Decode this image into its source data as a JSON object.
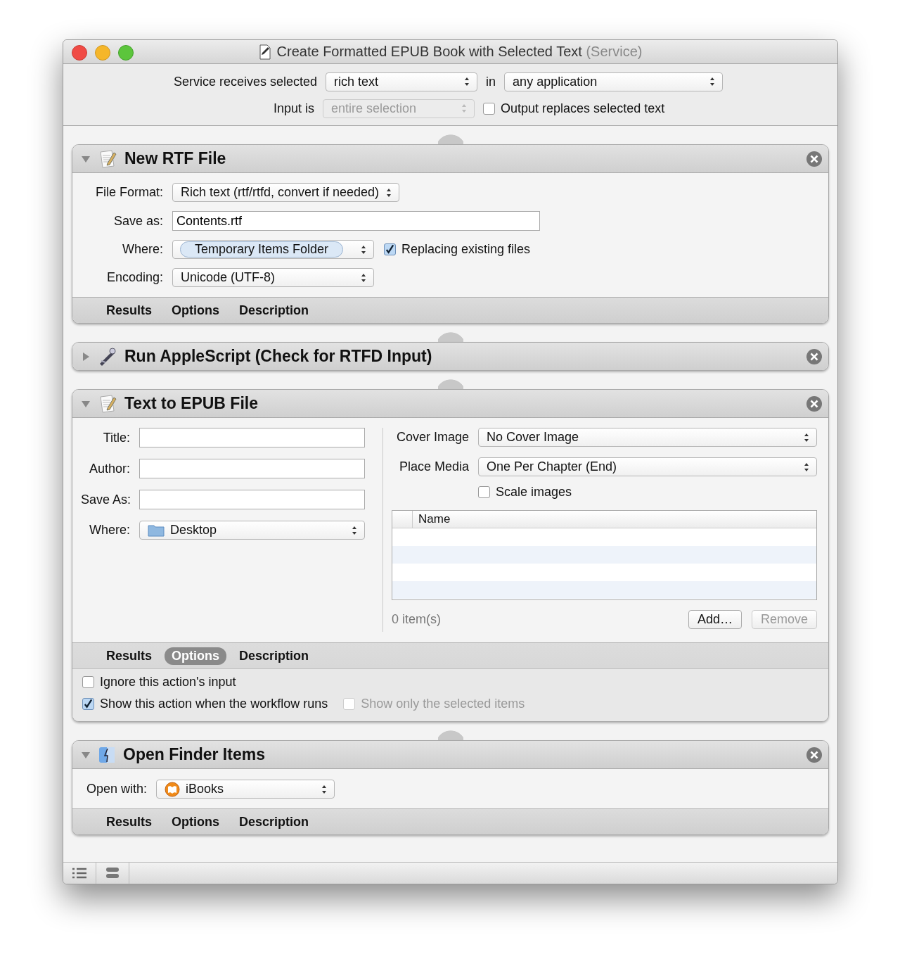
{
  "window": {
    "title": "Create Formatted EPUB Book with Selected Text",
    "title_note": "(Service)"
  },
  "service": {
    "receives_label": "Service receives selected",
    "receives_value": "rich text",
    "in_label": "in",
    "in_value": "any application",
    "input_label": "Input is",
    "input_value": "entire selection",
    "input_disabled": true,
    "output_replaces": {
      "label": "Output replaces selected text",
      "checked": false
    }
  },
  "actions": [
    {
      "kind": "new_rtf",
      "title": "New RTF File",
      "expanded": true,
      "fields": [
        {
          "kind": "popup",
          "label": "File Format:",
          "value": "Rich text (rtf/rtfd, convert if needed)"
        },
        {
          "kind": "text",
          "label": "Save as:",
          "value": "Contents.rtf"
        },
        {
          "kind": "folder_popup",
          "label": "Where:",
          "value": "Temporary Items Folder",
          "checkbox": {
            "label": "Replacing existing files",
            "checked": true
          }
        },
        {
          "kind": "popup",
          "label": "Encoding:",
          "value": "Unicode (UTF-8)"
        }
      ],
      "tabs": [
        {
          "label": "Results",
          "selected": false
        },
        {
          "label": "Options",
          "selected": false
        },
        {
          "label": "Description",
          "selected": false
        }
      ]
    },
    {
      "kind": "applescript",
      "title": "Run AppleScript (Check for RTFD Input)",
      "expanded": false
    },
    {
      "kind": "text_to_epub",
      "title": "Text to EPUB File",
      "expanded": true,
      "left_fields": [
        {
          "kind": "text",
          "label": "Title:"
        },
        {
          "kind": "text",
          "label": "Author:"
        },
        {
          "kind": "text",
          "label": "Save As:"
        },
        {
          "kind": "desktop_popup",
          "label": "Where:",
          "value": "Desktop"
        }
      ],
      "right_fields": [
        {
          "kind": "popup",
          "label": "Cover Image",
          "value": "No Cover Image"
        },
        {
          "kind": "popup",
          "label": "Place Media",
          "value": "One Per Chapter (End)"
        }
      ],
      "scale_images": {
        "label": "Scale images",
        "checked": false
      },
      "table": {
        "columns": [
          "Name"
        ],
        "count": "0 item(s)"
      },
      "buttons": [
        {
          "label": "Add…",
          "disabled": false
        },
        {
          "label": "Remove",
          "disabled": true
        }
      ],
      "tabs": [
        {
          "label": "Results",
          "selected": false
        },
        {
          "label": "Options",
          "selected": true
        },
        {
          "label": "Description",
          "selected": false
        }
      ],
      "options": [
        {
          "label": "Ignore this action's input",
          "checked": false,
          "disabled": false
        },
        {
          "label": "Show this action when the workflow runs",
          "checked": true,
          "disabled": false
        },
        {
          "label": "Show only the selected items",
          "checked": false,
          "disabled": true
        }
      ]
    },
    {
      "kind": "open_finder",
      "title": "Open Finder Items",
      "expanded": true,
      "fields": [
        {
          "kind": "app_popup",
          "label": "Open with:",
          "value": "iBooks"
        }
      ],
      "tabs": [
        {
          "label": "Results",
          "selected": false
        },
        {
          "label": "Options",
          "selected": false
        },
        {
          "label": "Description",
          "selected": false
        }
      ]
    }
  ]
}
